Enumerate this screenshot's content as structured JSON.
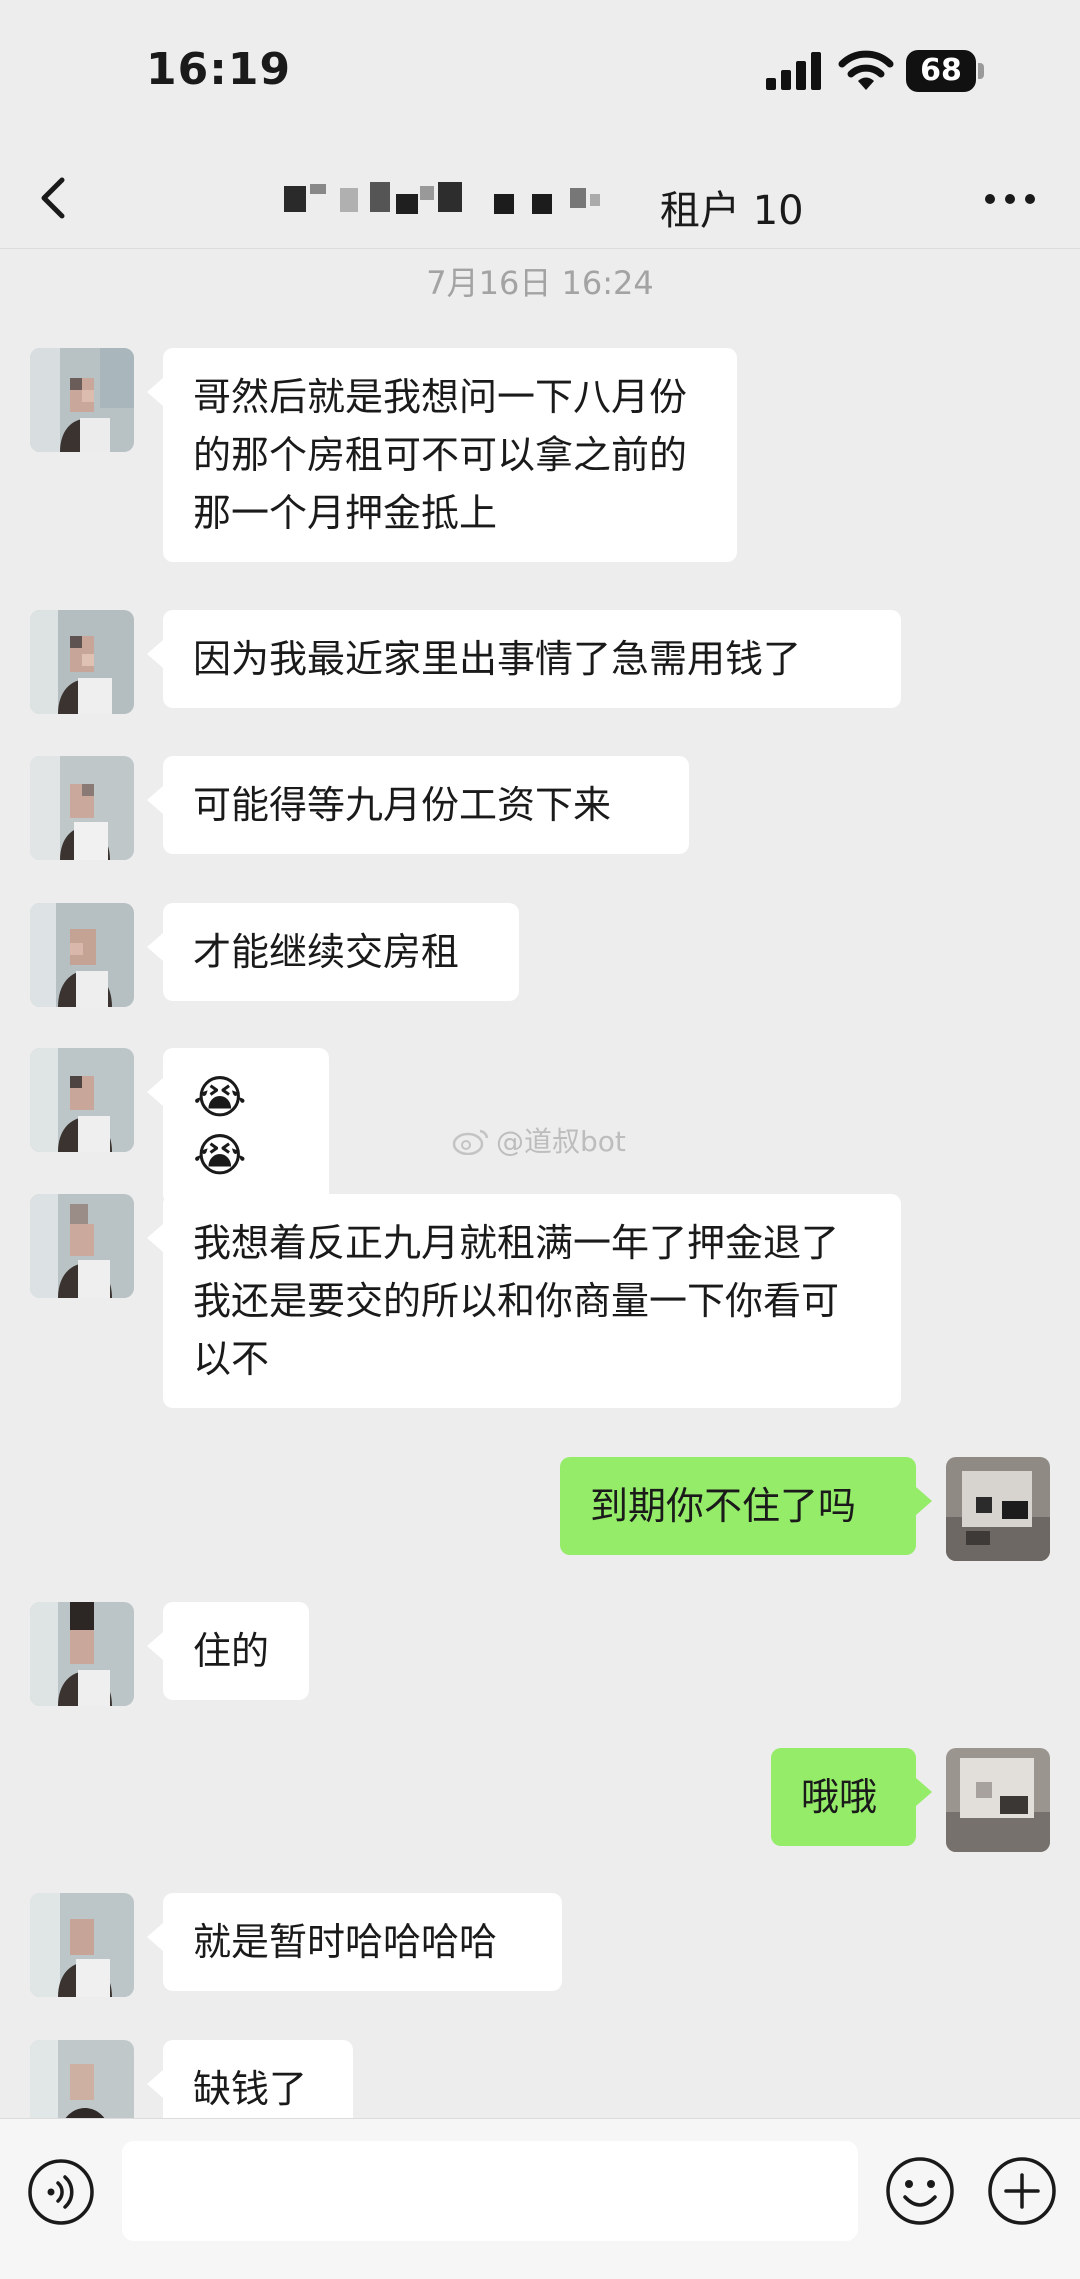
{
  "status_bar": {
    "time": "16:19",
    "battery": "68"
  },
  "header": {
    "title": "租户 10",
    "back_icon": "chevron-left-icon",
    "more_icon": "more-dots-icon"
  },
  "timestamp": "7月16日 16:24",
  "messages": [
    {
      "from": "contact",
      "text": "哥然后就是我想问一下八月份的那个房租可不可以拿之前的那一个月押金抵上"
    },
    {
      "from": "contact",
      "text": "因为我最近家里出事情了急需用钱了"
    },
    {
      "from": "contact",
      "text": "可能得等九月份工资下来"
    },
    {
      "from": "contact",
      "text": "才能继续交房租"
    },
    {
      "from": "contact",
      "text": "😭😭"
    },
    {
      "from": "contact",
      "text": "我想着反正九月就租满一年了押金退了我还是要交的所以和你商量一下你看可以不"
    },
    {
      "from": "me",
      "text": "到期你不住了吗"
    },
    {
      "from": "contact",
      "text": "住的"
    },
    {
      "from": "me",
      "text": "哦哦"
    },
    {
      "from": "contact",
      "text": "就是暂时哈哈哈哈"
    },
    {
      "from": "contact",
      "text": "缺钱了"
    }
  ],
  "watermark": "@道叔bot",
  "input_bar": {
    "voice_icon": "voice-icon",
    "emoji_icon": "smiley-icon",
    "plus_icon": "plus-circle-icon",
    "value": ""
  },
  "colors": {
    "background": "#ededed",
    "outgoing_bubble": "#95ec69",
    "incoming_bubble": "#ffffff"
  }
}
